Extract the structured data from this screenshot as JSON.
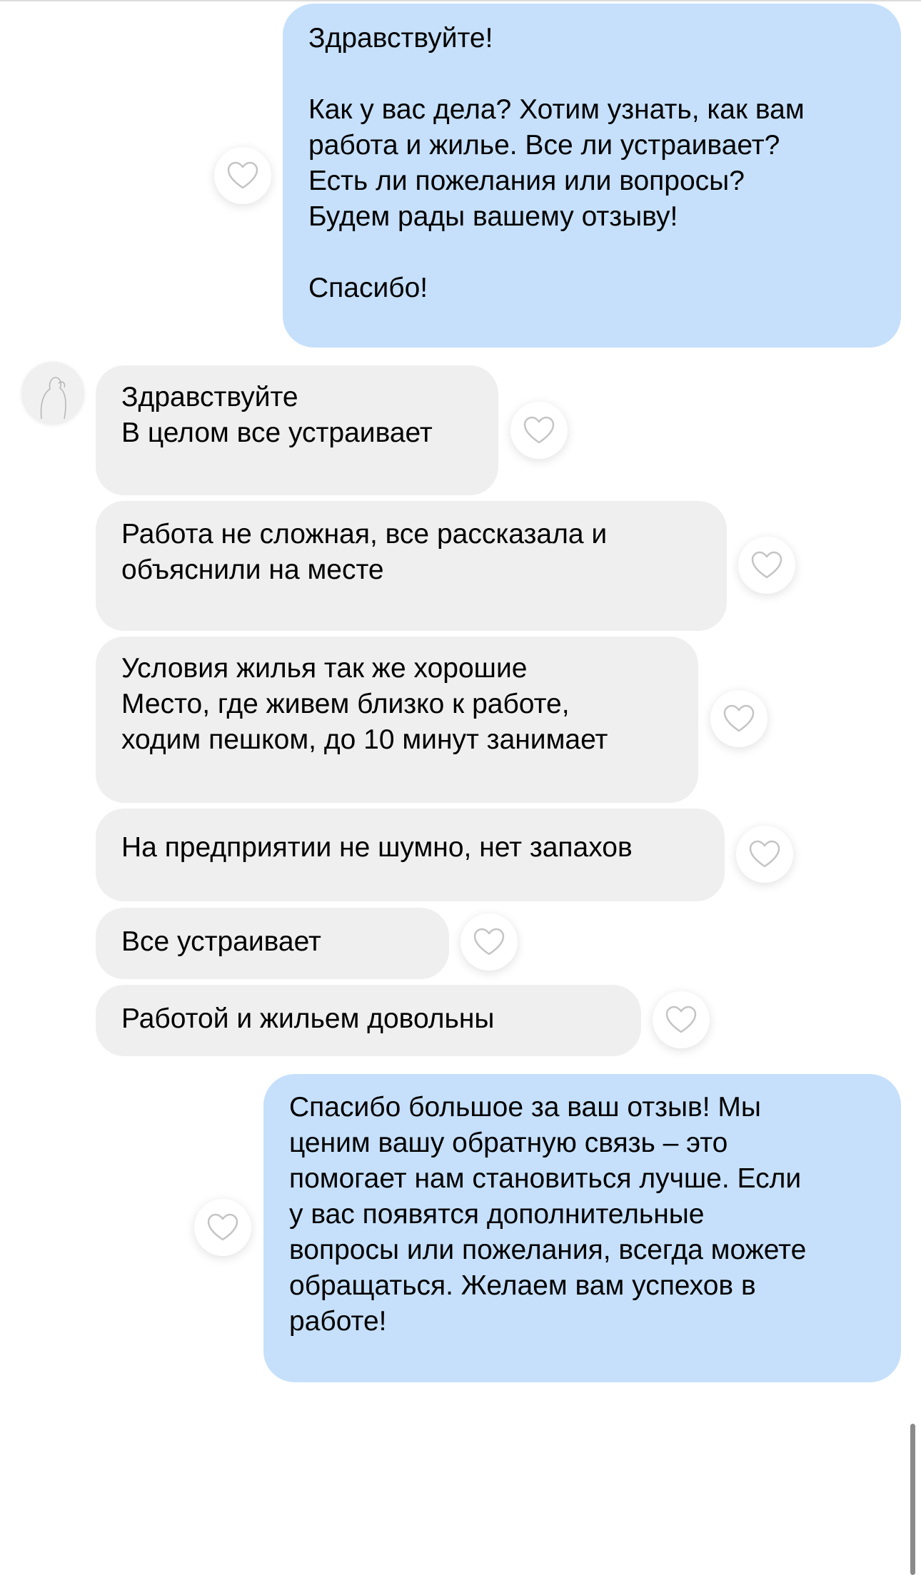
{
  "messages": [
    {
      "side": "out",
      "text": "Здравствуйте!\n\nКак у вас дела? Хотим узнать, как вам\nработа и жилье. Все ли устраивает?\nЕсть ли пожелания или вопросы?\nБудем рады вашему отзыву!\n\nСпасибо!"
    },
    {
      "side": "in",
      "text": "Здравствуйте\nВ целом все устраивает"
    },
    {
      "side": "in",
      "text": "Работа не сложная, все рассказала и\nобъяснили на месте"
    },
    {
      "side": "in",
      "text": "Условия жилья так же хорошие\nМесто, где живем близко к работе,\nходим пешком, до 10 минут занимает"
    },
    {
      "side": "in",
      "text": "На предприятии не шумно, нет запахов"
    },
    {
      "side": "in",
      "text": "Все устраивает"
    },
    {
      "side": "in",
      "text": "Работой и жильем довольны"
    },
    {
      "side": "out",
      "text": "Спасибо большое за ваш отзыв! Мы\nценим вашу обратную связь – это\nпомогает нам становиться лучше. Если\nу вас появятся дополнительные\nвопросы или пожелания, всегда можете\nобращаться. Желаем вам успехов в\nработе!"
    }
  ],
  "icons": {
    "reaction": "heart-outline-icon",
    "avatar": "contact-avatar"
  },
  "colors": {
    "outgoing_bubble": "#c6e0fb",
    "incoming_bubble": "#efefef",
    "heart_stroke": "#c4c4c4"
  }
}
